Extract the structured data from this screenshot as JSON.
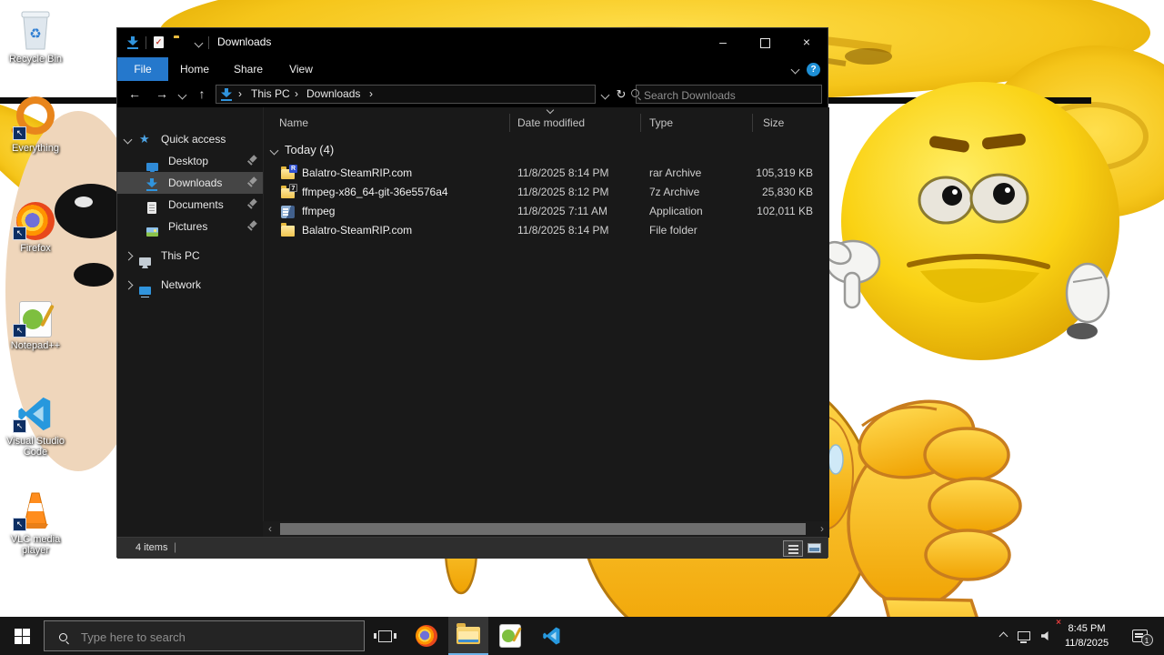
{
  "icons": {
    "minimize": "–",
    "close": "×",
    "back": "←",
    "forward": "→",
    "up": "↑",
    "refresh": "↻",
    "crumb_sep": "›",
    "help": "?",
    "star": "★",
    "check": "✓",
    "recycle": "♻",
    "scroll_left": "‹",
    "scroll_right": "›",
    "shortcut": "↖",
    "mute_x": "×",
    "rar_badge": "R",
    "z7_badge": "7"
  },
  "desktop": {
    "icons": [
      {
        "label": "Recycle Bin",
        "icon": "recycle-bin-icon"
      },
      {
        "label": "Everything",
        "icon": "everything-search-icon"
      },
      {
        "label": "Firefox",
        "icon": "firefox-icon"
      },
      {
        "label": "Notepad++",
        "icon": "notepad-plus-plus-icon"
      },
      {
        "label": "Visual Studio Code",
        "icon": "vscode-icon"
      },
      {
        "label": "VLC media player",
        "icon": "vlc-icon"
      }
    ]
  },
  "explorer": {
    "window_title": "Downloads",
    "tabs": [
      {
        "label": "File",
        "active": true
      },
      {
        "label": "Home",
        "active": false
      },
      {
        "label": "Share",
        "active": false
      },
      {
        "label": "View",
        "active": false
      }
    ],
    "breadcrumb": {
      "root": "This PC",
      "current": "Downloads"
    },
    "search": {
      "placeholder": "Search Downloads"
    },
    "sidebar": [
      {
        "label": "Quick access",
        "icon": "quick-access-star-icon",
        "expanded": true
      },
      {
        "label": "Desktop",
        "icon": "desktop-icon",
        "pinned": true
      },
      {
        "label": "Downloads",
        "icon": "downloads-arrow-icon",
        "pinned": true,
        "selected": true
      },
      {
        "label": "Documents",
        "icon": "document-icon",
        "pinned": true
      },
      {
        "label": "Pictures",
        "icon": "pictures-icon",
        "pinned": true
      },
      {
        "label": "This PC",
        "icon": "computer-icon",
        "collapsed": true
      },
      {
        "label": "Network",
        "icon": "network-icon",
        "collapsed": true
      }
    ],
    "columns": [
      {
        "label": "Name"
      },
      {
        "label": "Date modified",
        "sorted": true
      },
      {
        "label": "Type"
      },
      {
        "label": "Size"
      }
    ],
    "group_header": "Today (4)",
    "rows": [
      {
        "name": "Balatro-SteamRIP.com",
        "date": "11/8/2025 8:14 PM",
        "type": "rar Archive",
        "size": "105,319 KB",
        "icon": "rar-archive-icon"
      },
      {
        "name": "ffmpeg-x86_64-git-36e5576a4",
        "date": "11/8/2025 8:12 PM",
        "type": "7z Archive",
        "size": "25,830 KB",
        "icon": "7z-archive-icon"
      },
      {
        "name": "ffmpeg",
        "date": "11/8/2025 7:11 AM",
        "type": "Application",
        "size": "102,011 KB",
        "icon": "application-icon"
      },
      {
        "name": "Balatro-SteamRIP.com",
        "date": "11/8/2025 8:14 PM",
        "type": "File folder",
        "size": "",
        "icon": "folder-icon"
      }
    ],
    "status_bar": {
      "items_count": "4 items"
    }
  },
  "taskbar": {
    "search_placeholder": "Type here to search",
    "apps": [
      "firefox",
      "file-explorer",
      "notepad-plus-plus",
      "vscode"
    ],
    "active_app": "file-explorer",
    "tray": {
      "time": "8:45 PM",
      "date": "11/8/2025",
      "notification_count": "1"
    }
  },
  "colors": {
    "file_tab_blue": "#2578cc",
    "taskbar_underline": "#6cb2e8",
    "folder_yellow": "#f0c44e",
    "selection_gray": "#454545",
    "emoji_gold": "#fad214"
  }
}
